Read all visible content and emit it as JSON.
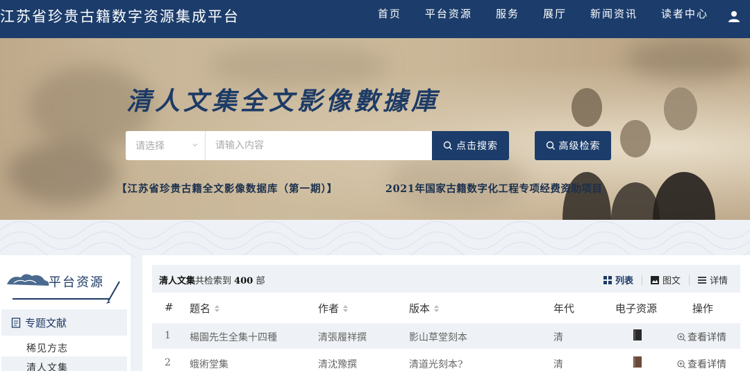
{
  "header": {
    "site_title": "江苏省珍贵古籍数字资源集成平台",
    "nav": [
      {
        "label": "首页",
        "active": true
      },
      {
        "label": "平台资源"
      },
      {
        "label": "服务"
      },
      {
        "label": "展厅"
      },
      {
        "label": "新闻资讯"
      },
      {
        "label": "读者中心"
      }
    ],
    "user_icon": "user-icon"
  },
  "banner": {
    "title": "清人文集全文影像數據庫",
    "select_placeholder": "请选择",
    "search_placeholder": "请输入内容",
    "search_button": "点击搜索",
    "advanced_button": "高级检索",
    "note_left": "【江苏省珍贵古籍全文影像数据库（第一期）】",
    "note_right": "2021年国家古籍数字化工程专项经费资助项目"
  },
  "sidebar": {
    "title": "平台资源",
    "category": "专题文献",
    "items": [
      "稀见方志",
      "清人文集"
    ]
  },
  "results": {
    "db_name": "清人文集",
    "prefix": "共检索到",
    "count": "400",
    "suffix": "部",
    "views": [
      {
        "label": "列表",
        "icon": "grid-icon",
        "active": true
      },
      {
        "label": "图文",
        "icon": "image-icon"
      },
      {
        "label": "详情",
        "icon": "list-icon"
      }
    ],
    "columns": {
      "index": "#",
      "title": "题名",
      "author": "作者",
      "edition": "版本",
      "era": "年代",
      "eresource": "电子资源",
      "action": "操作"
    },
    "rows": [
      {
        "index": "1",
        "title": "楊園先生全集十四種",
        "author": "清張履祥撰",
        "edition": "影山草堂刻本",
        "era": "清",
        "action": "查看详情",
        "book_color": "#2a2a2a"
      },
      {
        "index": "2",
        "title": "蛾術堂集",
        "author": "清沈豫撰",
        "edition": "清道光刻本?",
        "era": "清",
        "action": "查看详情",
        "book_color": "#6b4a3a"
      }
    ]
  },
  "colors": {
    "primary": "#1c3d6b",
    "light_bg": "#eef1f5"
  }
}
